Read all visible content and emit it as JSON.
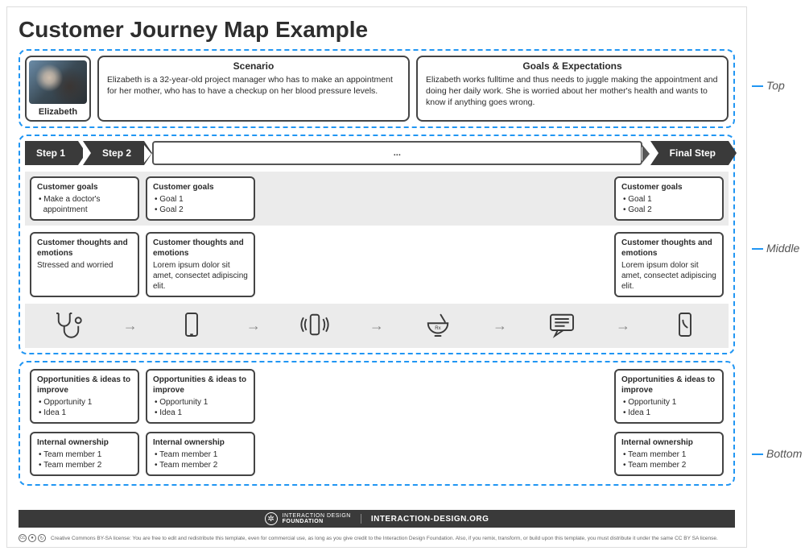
{
  "title": "Customer Journey Map Example",
  "annotations": {
    "top": "Top",
    "middle": "Middle",
    "bottom": "Bottom"
  },
  "persona": {
    "name": "Elizabeth"
  },
  "scenario": {
    "heading": "Scenario",
    "body": "Elizabeth is a 32-year-old project manager who has to make an appointment for her mother, who has to have a checkup on her blood pressure levels."
  },
  "goals": {
    "heading": "Goals & Expectations",
    "body": "Elizabeth works fulltime and thus needs to juggle making the appointment and doing her daily work. She is worried about her mother's health and wants to know if anything goes wrong."
  },
  "steps": {
    "s1": "Step 1",
    "s2": "Step 2",
    "ell": "...",
    "final": "Final Step"
  },
  "rows": {
    "goalsRow": {
      "c1": {
        "h": "Customer goals",
        "i1": "Make a doctor's",
        "i2": "appointment"
      },
      "c2": {
        "h": "Customer goals",
        "i1": "Goal 1",
        "i2": "Goal 2"
      },
      "c3": {
        "h": "Customer goals",
        "i1": "Goal 1",
        "i2": "Goal 2"
      }
    },
    "thoughtsRow": {
      "c1": {
        "h": "Customer thoughts and emotions",
        "b": "Stressed and worried"
      },
      "c2": {
        "h": "Customer thoughts and emotions",
        "b": "Lorem ipsum dolor sit amet, consectet adipiscing elit."
      },
      "c3": {
        "h": "Customer thoughts and emotions",
        "b": "Lorem ipsum dolor sit amet, consectet adipiscing elit."
      }
    },
    "oppRow": {
      "c1": {
        "h": "Opportunities & ideas to improve",
        "i1": "Opportunity 1",
        "i2": "Idea 1"
      },
      "c2": {
        "h": "Opportunities & ideas to improve",
        "i1": "Opportunity 1",
        "i2": "Idea 1"
      },
      "c3": {
        "h": "Opportunities & ideas to improve",
        "i1": "Opportunity 1",
        "i2": "Idea 1"
      }
    },
    "ownRow": {
      "c1": {
        "h": "Internal ownership",
        "i1": "Team member 1",
        "i2": "Team member 2"
      },
      "c2": {
        "h": "Internal ownership",
        "i1": "Team member 1",
        "i2": "Team member 2"
      },
      "c3": {
        "h": "Internal ownership",
        "i1": "Team member 1",
        "i2": "Team member 2"
      }
    }
  },
  "icons": [
    "stethoscope",
    "phone",
    "phone-ringing",
    "mortar-pestle",
    "chat",
    "phone-call"
  ],
  "footer": {
    "org1": "INTERACTION DESIGN",
    "org2": "FOUNDATION",
    "url": "INTERACTION-DESIGN.ORG"
  },
  "license": {
    "text": "Creative Commons BY-SA license: You are free to edit and redistribute this template, even for commercial use, as long as you give credit to the Interaction Design Foundation. Also, if you remix, transform, or build upon this template, you must distribute it under the same CC BY SA license."
  }
}
